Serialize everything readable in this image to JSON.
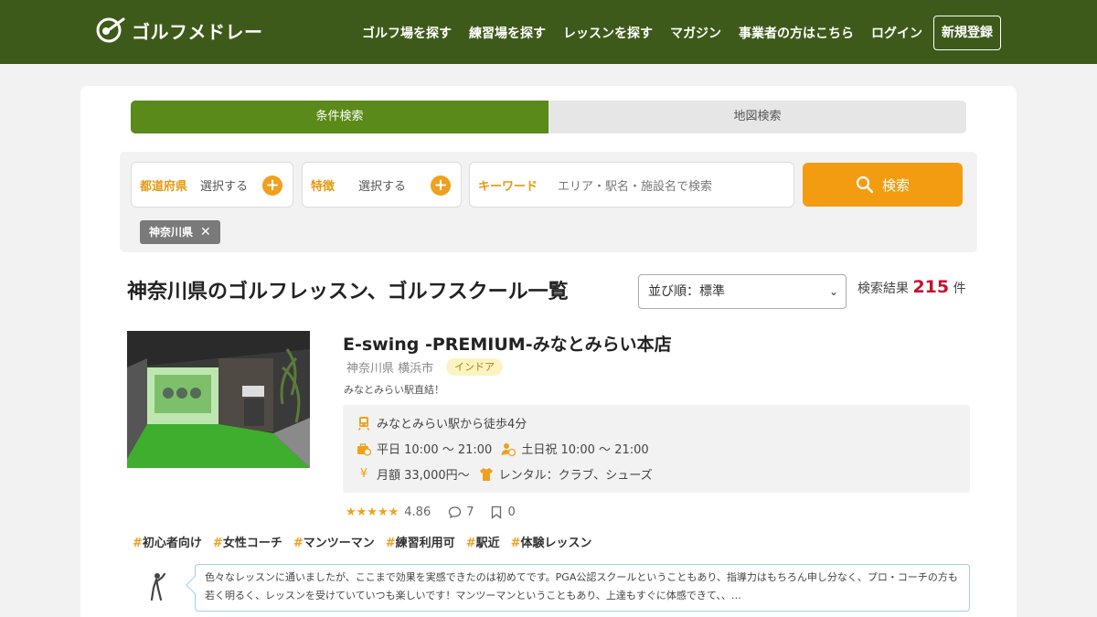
{
  "header": {
    "logo_text": "ゴルフメドレー",
    "nav": [
      "ゴルフ場を探す",
      "練習場を探す",
      "レッスンを探す",
      "マガジン",
      "事業者の方はこちら",
      "ログイン"
    ],
    "signup_label": "新規登録",
    "bg_color": "#3d5a1a"
  },
  "tabs": {
    "active": "条件検索",
    "inactive": "地図検索"
  },
  "search": {
    "prefecture_label": "都道府県",
    "prefecture_value": "選択する",
    "feature_label": "特徴",
    "feature_value": "選択する",
    "keyword_label": "キーワード",
    "keyword_placeholder": "エリア・駅名・施設名で検索",
    "button_label": "検索",
    "selected_chip": "神奈川県"
  },
  "listing": {
    "title": "神奈川県のゴルフレッスン、ゴルフスクール一覧",
    "sort_label": "並び順：標準",
    "result_prefix": "検索結果",
    "result_count": "215",
    "result_suffix": "件"
  },
  "card": {
    "name": "E-swing -PREMIUM-みなとみらい本店",
    "location": "神奈川県 横浜市",
    "badge": "インドア",
    "catch": "みなとみらい駅直結！",
    "access": "みなとみらい駅から徒歩4分",
    "weekday_hours": "平日 10:00 〜 21:00",
    "holiday_hours": "土日祝 10:00 〜 21:00",
    "price": "月額 33,000円〜",
    "rental": "レンタル：クラブ、シューズ",
    "stars": "★★★★★",
    "rating": "4.86",
    "comments": "7",
    "bookmarks": "0",
    "tags": [
      "初心者向け",
      "女性コーチ",
      "マンツーマン",
      "練習利用可",
      "駅近",
      "体験レッスン"
    ],
    "review": "色々なレッスンに通いましたが、ここまで効果を実感できたのは初めてです。PGA公認スクールということもあり、指導力はもちろん申し分なく、プロ・コーチの方も若く明るく、レッスンを受けていていつも楽しいです！マンツーマンということもあり、上達もすぐに体感できて、、…"
  },
  "colors": {
    "accent_green": "#5a8a19",
    "accent_orange": "#f39c12",
    "result_red": "#c8102e"
  }
}
